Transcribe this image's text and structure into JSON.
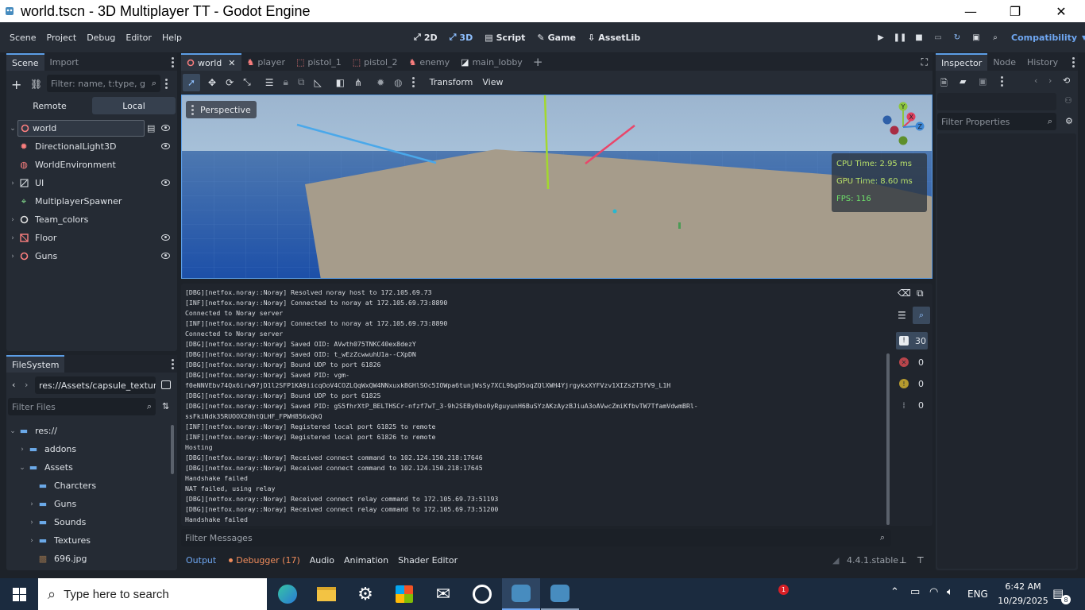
{
  "window": {
    "title": "world.tscn - 3D Multiplayer TT - Godot Engine",
    "minimize": "—",
    "maximize": "❐",
    "close": "✕"
  },
  "menu": {
    "items": [
      "Scene",
      "Project",
      "Debug",
      "Editor",
      "Help"
    ]
  },
  "workspaces": {
    "b2d": "2D",
    "b3d": "3D",
    "script": "Script",
    "game": "Game",
    "assetlib": "AssetLib",
    "active": "3D"
  },
  "renderer": "Compatibility",
  "scene_dock": {
    "tabs": [
      "Scene",
      "Import"
    ],
    "filter_placeholder": "Filter: name, t:type, g:gr",
    "remote": "Remote",
    "local": "Local",
    "nodes": [
      {
        "label": "world",
        "icon": "node3d-icon",
        "color": "#fc7f7f"
      },
      {
        "label": "DirectionalLight3D",
        "icon": "light-icon",
        "color": "#fc7f7f"
      },
      {
        "label": "WorldEnvironment",
        "icon": "globe-icon",
        "color": "#fc7f7f"
      },
      {
        "label": "UI",
        "icon": "control-icon",
        "color": "#ffffff"
      },
      {
        "label": "MultiplayerSpawner",
        "icon": "spawner-icon",
        "color": "#8eef97"
      },
      {
        "label": "Team_colors",
        "icon": "node-icon",
        "color": "#e0e0e0"
      },
      {
        "label": "Floor",
        "icon": "csg-icon",
        "color": "#fc7f7f"
      },
      {
        "label": "Guns",
        "icon": "node3d-icon",
        "color": "#fc7f7f"
      }
    ]
  },
  "filesystem": {
    "tab": "FileSystem",
    "path": "res://Assets/capsule_texture.p",
    "filter_placeholder": "Filter Files",
    "items": [
      {
        "label": "res://"
      },
      {
        "label": "addons"
      },
      {
        "label": "Assets"
      },
      {
        "label": "Charcters"
      },
      {
        "label": "Guns"
      },
      {
        "label": "Sounds"
      },
      {
        "label": "Textures"
      },
      {
        "label": "696.jpg"
      }
    ]
  },
  "editor_tabs": [
    {
      "label": "world",
      "icon": "node3d-icon"
    },
    {
      "label": "player",
      "icon": "body-icon"
    },
    {
      "label": "pistol_1",
      "icon": "area-icon"
    },
    {
      "label": "pistol_2",
      "icon": "area-icon"
    },
    {
      "label": "enemy",
      "icon": "body-icon"
    },
    {
      "label": "main_lobby",
      "icon": "control-icon"
    }
  ],
  "toolbar": {
    "transform": "Transform",
    "view": "View"
  },
  "viewport": {
    "perspective": "Perspective",
    "cpu_time": "CPU Time: 2.95 ms",
    "gpu_time": "GPU Time: 8.60 ms",
    "fps": "FPS: 116",
    "gizmo": {
      "y": "Y",
      "x": "X",
      "z": "Z"
    }
  },
  "output": {
    "lines": [
      "[DBG][netfox.noray::Noray] Resolved noray host to 172.105.69.73",
      "[INF][netfox.noray::Noray] Connected to noray at 172.105.69.73:8890",
      "Connected to Noray server",
      "[INF][netfox.noray::Noray] Connected to noray at 172.105.69.73:8890",
      "Connected to Noray server",
      "[DBG][netfox.noray::Noray] Saved OID: AVwth075TNKC40ex8dezY",
      "[DBG][netfox.noray::Noray] Saved OID: t_wEzZcwwuhU1a--CXpDN",
      "[DBG][netfox.noray::Noray] Bound UDP to port 61826",
      "[DBG][netfox.noray::Noray] Saved PID: vgm-",
      "f0eNNVEbv74Qx6irw97jD1l2SFP1KA9iicqOoV4COZLQqWxQW4NNxuxkBGHlSOc5IOWpa6tunjWsSy7XCL9bgD5oqZQlXWH4YjrgykxXYFVzv1XIZs2T3fV9_L1H",
      "[DBG][netfox.noray::Noray] Bound UDP to port 61825",
      "[DBG][netfox.noray::Noray] Saved PID: gS5fhrXtP_BELTHSCr-nfzf7wT_3-9h2SEBy0bo0yRguyunH6BuSYzAKzAyzBJiuA3oAVwcZmiKfbvTW7TfamVdwmBRl-",
      "ssFkiNdk35RUOOX20htQLHF_FPWH856xQkQ",
      "[INF][netfox.noray::Noray] Registered local port 61825 to remote",
      "[INF][netfox.noray::Noray] Registered local port 61826 to remote",
      "Hosting",
      "[DBG][netfox.noray::Noray] Received connect command to 102.124.150.218:17646",
      "[DBG][netfox.noray::Noray] Received connect command to 102.124.150.218:17645",
      "Handshake failed",
      "NAT failed, using relay",
      "[DBG][netfox.noray::Noray] Received connect relay command to 172.105.69.73:51193",
      "[DBG][netfox.noray::Noray] Received connect relay command to 172.105.69.73:51200",
      "Handshake failed"
    ],
    "filter_placeholder": "Filter Messages",
    "counts": {
      "messages": "30",
      "errors": "0",
      "warnings": "0",
      "editor": "0"
    }
  },
  "bottom_tabs": {
    "output": "Output",
    "debugger": "Debugger (17)",
    "audio": "Audio",
    "animation": "Animation",
    "shader_editor": "Shader Editor"
  },
  "version": "4.4.1.stable",
  "inspector": {
    "tabs": [
      "Inspector",
      "Node",
      "History"
    ],
    "filter_placeholder": "Filter Properties"
  },
  "taskbar": {
    "search_placeholder": "Type here to search",
    "time": "6:42 AM",
    "date": "10/29/2025",
    "lang": "ENG",
    "notification_badge": "1",
    "action_center_count": "8",
    "apps": [
      "edge-icon",
      "file-explorer-icon",
      "chatgpt-icon",
      "store-icon",
      "mail-icon",
      "obs-icon",
      "godot-icon",
      "godot-icon"
    ]
  }
}
